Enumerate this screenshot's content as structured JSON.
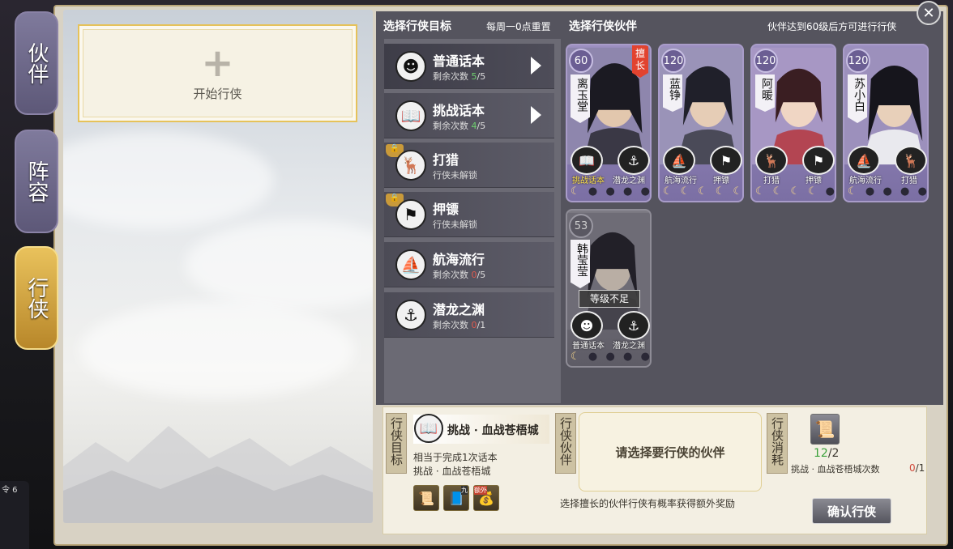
{
  "side_tabs": [
    {
      "label": "伙伴",
      "active": false
    },
    {
      "label": "阵容",
      "active": false
    },
    {
      "label": "行侠",
      "active": true
    }
  ],
  "left": {
    "start_label": "开始行侠",
    "bottom_corner_text": "令 6"
  },
  "header": {
    "select_goal": "选择行侠目标",
    "weekly_reset": "每周一0点重置",
    "select_partner": "选择行侠伙伴",
    "level_note": "伙伴达到60级后方可进行行侠"
  },
  "goals": [
    {
      "name": "普通话本",
      "prefix": "剩余次数 ",
      "count": "5",
      "count_color": "green",
      "total": "/5",
      "has_arrow": true,
      "locked": false,
      "icon": "opera-mask-icon"
    },
    {
      "name": "挑战话本",
      "prefix": "剩余次数 ",
      "count": "4",
      "count_color": "green",
      "total": "/5",
      "has_arrow": true,
      "locked": false,
      "icon": "book-icon"
    },
    {
      "name": "打猎",
      "prefix": "行侠未解锁",
      "count": "",
      "count_color": "",
      "total": "",
      "has_arrow": false,
      "locked": true,
      "icon": "deer-icon"
    },
    {
      "name": "押镖",
      "prefix": "行侠未解锁",
      "count": "",
      "count_color": "",
      "total": "",
      "has_arrow": false,
      "locked": true,
      "icon": "flag-icon"
    },
    {
      "name": "航海流行",
      "prefix": "剩余次数 ",
      "count": "0",
      "count_color": "red",
      "total": "/5",
      "has_arrow": false,
      "locked": false,
      "icon": "ship-icon"
    },
    {
      "name": "潜龙之渊",
      "prefix": "剩余次数 ",
      "count": "0",
      "count_color": "red",
      "total": "/1",
      "has_arrow": false,
      "locked": false,
      "icon": "ship-crossed-icon"
    }
  ],
  "partners": [
    {
      "name": "离玉堂",
      "level": "60",
      "speciality": "擅长",
      "tags": [
        "挑战话本",
        "潜龙之渊"
      ],
      "highlight_first": true,
      "moons_full": 1,
      "moons_total": 5,
      "locked": false,
      "insufficient": ""
    },
    {
      "name": "蓝铮",
      "level": "120",
      "speciality": "",
      "tags": [
        "航海流行",
        "押镖"
      ],
      "highlight_first": false,
      "moons_full": 5,
      "moons_total": 5,
      "locked": false,
      "insufficient": ""
    },
    {
      "name": "阿暖",
      "level": "120",
      "speciality": "",
      "tags": [
        "打猎",
        "押镖"
      ],
      "highlight_first": false,
      "moons_full": 4,
      "moons_total": 5,
      "locked": false,
      "insufficient": ""
    },
    {
      "name": "苏小白",
      "level": "120",
      "speciality": "",
      "tags": [
        "航海流行",
        "打猎"
      ],
      "highlight_first": false,
      "moons_full": 1,
      "moons_total": 5,
      "locked": false,
      "insufficient": ""
    },
    {
      "name": "韩莹莹",
      "level": "53",
      "speciality": "",
      "tags": [
        "普通话本",
        "潜龙之渊"
      ],
      "highlight_first": false,
      "moons_full": 1,
      "moons_total": 5,
      "locked": true,
      "insufficient": "等级不足"
    }
  ],
  "bottom": {
    "target_label": "行侠目标",
    "target_name": "挑战 · 血战苍梧城",
    "target_desc1": "相当于完成1次话本",
    "target_desc2": "挑战 · 血战苍梧城",
    "rewards": [
      {
        "icon": "scroll-reward-icon",
        "tag": ""
      },
      {
        "icon": "book-reward-icon",
        "tag": "九"
      },
      {
        "icon": "bag-reward-icon",
        "tag": "额外"
      }
    ],
    "partner_label": "行侠伙伴",
    "select_prompt": "请选择要行侠的伙伴",
    "hint": "选择擅长的伙伴行侠有概率获得额外奖励",
    "cost_label": "行侠消耗",
    "cost_have": "12",
    "cost_need": "/2",
    "cost_desc": "挑战 · 血战苍梧城次数",
    "cost_count_have": "0",
    "cost_count_total": "/1",
    "confirm": "确认行侠"
  },
  "close_icon": "close-icon",
  "colors": {
    "accent_gold": "#e6c25a",
    "green": "#6fd16f",
    "red": "#e05a4e",
    "panel": "#55545e"
  }
}
